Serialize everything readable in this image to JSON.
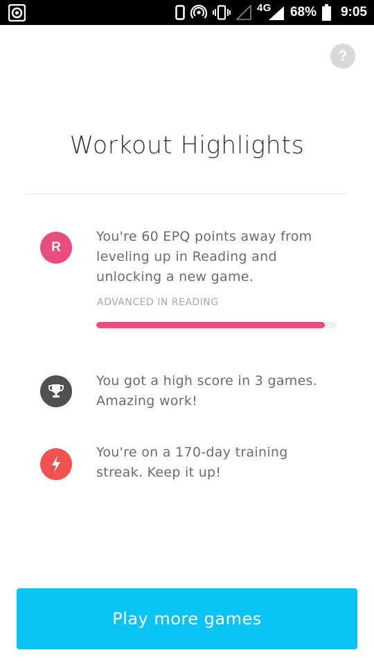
{
  "status_bar": {
    "network_type": "4G",
    "battery_percent": "68%",
    "time": "9:05",
    "icons": [
      "camera-app-icon",
      "phone-icon",
      "hotspot-icon",
      "vibrate-icon",
      "signal-empty-icon",
      "signal-full-icon",
      "battery-icon"
    ]
  },
  "help": {
    "label": "?"
  },
  "title": "Workout Highlights",
  "highlights": [
    {
      "badge_letter": "R",
      "badge_color": "#e94d7f",
      "text": "You're 60 EPQ points away from leveling up in Reading and unlocking a new game.",
      "sublabel": "ADVANCED IN READING",
      "progress": 0.95
    },
    {
      "icon": "trophy-icon",
      "badge_color": "#505050",
      "text": "You got a high score in 3 games. Amazing work!"
    },
    {
      "icon": "lightning-icon",
      "badge_color": "#f2524f",
      "text": "You're on a 170-day training streak. Keep it up!"
    }
  ],
  "cta": {
    "label": "Play more games",
    "color": "#08c4f5"
  }
}
